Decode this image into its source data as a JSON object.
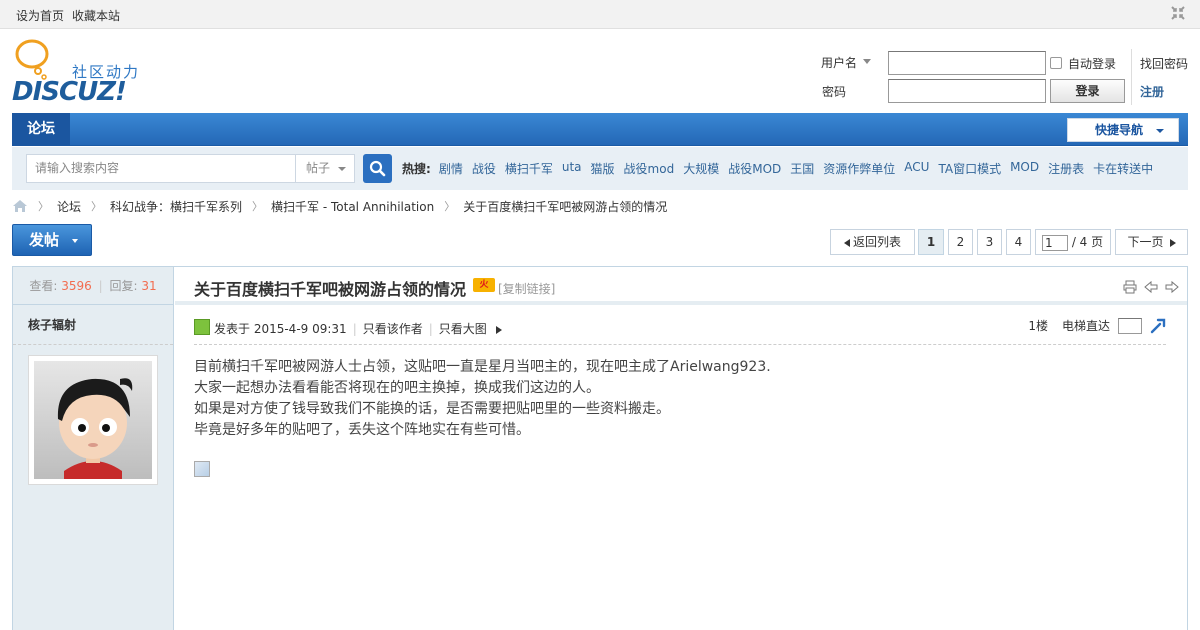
{
  "topbar": {
    "set_home": "设为首页",
    "bookmark": "收藏本站"
  },
  "logo": {
    "slogan": "社区动力",
    "word": "DISCUZ!"
  },
  "login": {
    "username_label": "用户名",
    "password_label": "密码",
    "auto_login": "自动登录",
    "login_button": "登录",
    "find_password": "找回密码",
    "register": "注册"
  },
  "nav": {
    "forum_tab": "论坛",
    "quick_nav": "快捷导航"
  },
  "search": {
    "placeholder": "请输入搜索内容",
    "type": "帖子",
    "hot_label": "热搜:",
    "hot_items": [
      "剧情",
      "战役",
      "横扫千军",
      "uta",
      "猫版",
      "战役mod",
      "大规模",
      "战役MOD",
      "王国",
      "资源作弊单位",
      "ACU",
      "TA窗口模式",
      "MOD",
      "注册表",
      "卡在转送中"
    ]
  },
  "breadcrumb": [
    "论坛",
    "科幻战争：横扫千军系列",
    "横扫千军 - Total Annihilation",
    "关于百度横扫千军吧被网游占领的情况"
  ],
  "pager": {
    "post_button": "发帖",
    "back_to_list": "返回列表",
    "pages": [
      "1",
      "2",
      "3",
      "4"
    ],
    "current_page": "1",
    "page_input": "1",
    "total": "/ 4 页",
    "next": "下一页"
  },
  "thread": {
    "views_label": "查看:",
    "views": "3596",
    "replies_label": "回复:",
    "replies": "31",
    "title": "关于百度横扫千军吧被网游占领的情况",
    "hot_badge": "火",
    "copy_link": "[复制链接]",
    "author": "核子辐射",
    "posted_at": "发表于 2015-4-9 09:31",
    "only_author": "只看该作者",
    "big_image": "只看大图",
    "floor": "1楼",
    "jump_label": "电梯直达",
    "content": [
      "目前横扫千军吧被网游人士占领，这贴吧一直是星月当吧主的，现在吧主成了Arielwang923.",
      "大家一起想办法看看能否将现在的吧主换掉，换成我们这边的人。",
      "如果是对方使了钱导致我们不能换的话，是否需要把贴吧里的一些资料搬走。",
      "毕竟是好多年的贴吧了，丢失这个阵地实在有些可惜。"
    ]
  },
  "colors": {
    "accent": "#2468b6",
    "count": "#f26c4f",
    "link": "#336699"
  }
}
